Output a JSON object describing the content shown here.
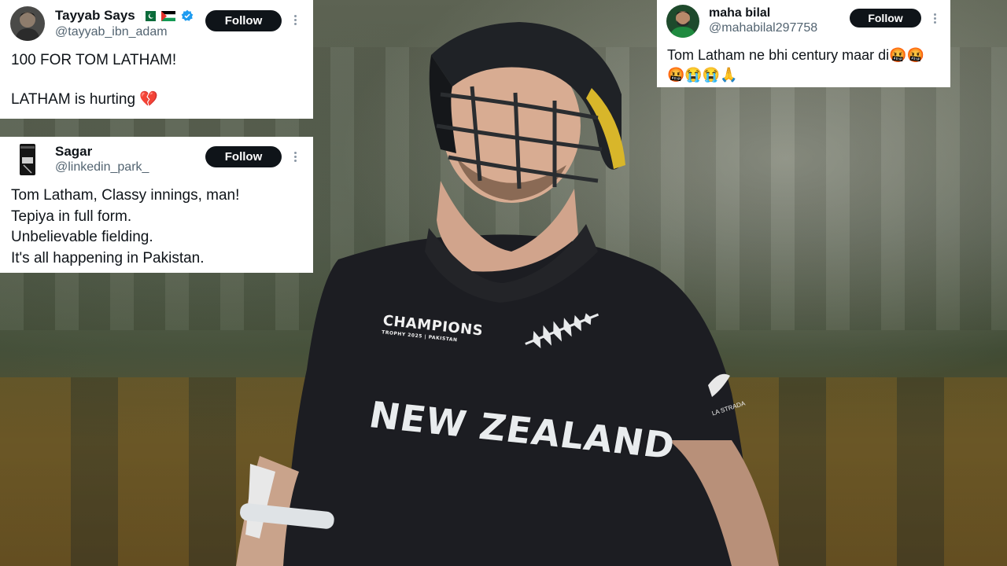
{
  "tweets": [
    {
      "name": "Tayyab Says",
      "handle": "@tayyab_ibn_adam",
      "verified": true,
      "follow_label": "Follow",
      "lines": [
        "100 FOR TOM LATHAM!",
        "",
        "LATHAM is hurting 💔"
      ]
    },
    {
      "name": "Sagar",
      "handle": "@linkedin_park_",
      "follow_label": "Follow",
      "lines": [
        "Tom Latham, Classy innings, man!",
        "Tepiya in full form.",
        "Unbelievable fielding.",
        "It's all happening in Pakistan."
      ]
    },
    {
      "name": "maha bilal",
      "handle": "@mahabilal297758",
      "follow_label": "Follow",
      "lines": [
        "Tom Latham ne bhi century maar di🤬🤬",
        "🤬😭😭🙏"
      ]
    }
  ],
  "photo": {
    "shirt_text": "NEW ZEALAND",
    "shirt_logo": "CHAMPIONS",
    "shirt_logo_sub": "TROPHY 2025 | PAKISTAN",
    "shirt_brand": "LA STRADA"
  },
  "colors": {
    "follow_bg": "#0f1419",
    "handle": "#536471",
    "verified": "#1d9bf0",
    "jersey": "#1c1d22"
  }
}
